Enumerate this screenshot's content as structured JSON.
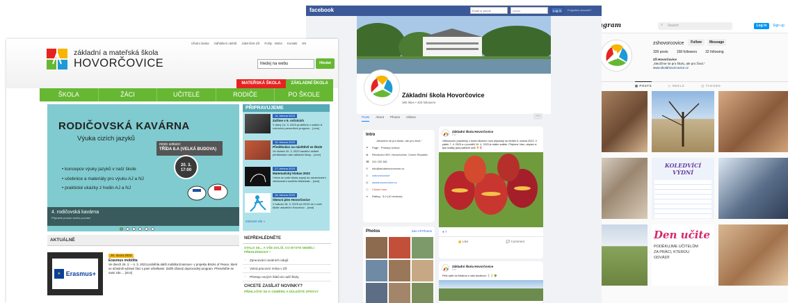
{
  "instagram": {
    "logo": "Instagram",
    "search_placeholder": "Search",
    "login": "Log in",
    "signup": "Sign up",
    "handle": "zshovorcovice",
    "follow": "Follow",
    "message": "Message",
    "stats": [
      "339 posts",
      "158 followers",
      "32 following"
    ],
    "bio_name": "ZŠ Hovorčovice",
    "bio_line": "„Neučíme se pro školu, ale pro život.“",
    "bio_link": "www.skolahovorcovice.cz",
    "tabs": [
      "POSTS",
      "REELS",
      "TAGGED"
    ],
    "tile_koledy": "KOLEDVÍCÍ VÝDNÍ",
    "tile_den_ucitelu": "Den učite",
    "tile_den_sub": "PODĚKUJME UČITELŮM ZA PRÁCI, KTEROU ODVÁDÍ!"
  },
  "facebook": {
    "logo": "facebook",
    "email_placeholder": "Email or phone",
    "password_mask": "••••••••",
    "login": "Log in",
    "forgot": "Forgotten account?",
    "page_name": "Základní škola Hovorčovice",
    "likes": "380 likes • 400 followers",
    "tabs": [
      "Posts",
      "About",
      "Photos",
      "Videos"
    ],
    "more": "···",
    "intro_title": "Intro",
    "intro_quote": "„Neučíme se pro školu, ale pro život.“",
    "intro_rows": [
      "Page · Primary school",
      "Revoluční 900, Hovorčovice, Czech Republic",
      "311 232 381",
      "info@skolahovorcovice.cz",
      "zshovorcovice",
      "skolahovorcovice.cz",
      "Closed now",
      "Rating · 5.0 (10 reviews)"
    ],
    "photos_title": "Photos",
    "photos_link": "See All Photos",
    "post1_name": "Základní škola Hovorčovice",
    "post1_time": "2 d ·",
    "post1_text": "Velikonoční prázdniny v tomto školním roce připadají na čtvrtek 6. dubna 2023. V pátek 7. 4. 2023 a v pondělí 10. 4. 2023 je státní svátek. Přejeme Vám, abyste si tyto svátky jara patřičně užili 🐣🌷",
    "reactions": "7",
    "like": "Like",
    "comment": "Comment",
    "post2_name": "Základní škola Hovorčovice",
    "post2_time": "4 d ·",
    "post2_text": "Pěší výlet do Mratína s naší družinou! 🚶🚶🌳"
  },
  "school": {
    "top_links": [
      "Úřední deska",
      "Odhlášení obědů",
      "Jídelníček ZŠ",
      "Pošty · Webs",
      "Kontakt",
      "EN"
    ],
    "title1": "základní a mateřská škola",
    "title2": "HOVORČOVICE",
    "search_value": "hledej na webu",
    "search_btn": "Hledat",
    "seg_ms": "MATEŘSKÁ ŠKOLA",
    "seg_zs": "ZÁKLADNÍ ŠKOLA",
    "nav": [
      "ŠKOLA",
      "ŽÁCI",
      "UČITELÉ",
      "RODIČE",
      "PO ŠKOLE"
    ],
    "banner": {
      "title": "RODIČOVSKÁ KAVÁRNA",
      "subtitle": "Výuka cizích jazyků",
      "pill_line1": "místo setkání:",
      "pill_line2": "TŘÍDA 8.A (VELKÁ BUDOVA)",
      "clock_date": "20. 3.",
      "clock_time": "17:00",
      "list": [
        "koncepce výuky jazyků v naší škole",
        "učebnice a materiály pro výuku AJ a NJ",
        "praktické ukázky z hodin AJ a NJ"
      ],
      "caption": "4. rodičovská kavárna",
      "caption_sub": "Připravte prosím svého pozvání"
    },
    "side": {
      "heading": "PŘIPRAVUJEME",
      "items": [
        {
          "date": "14. března 2023",
          "title": "Zuříme v 6. ročnících",
          "text": "V úterý 14. 3. 2023 proběhne v našich 6. ročnících preventivní program... [více]"
        },
        {
          "date": "16. března 2023",
          "title": "Předškoláci na návštěvě ve škole",
          "text": "Ve čtvrtek 16. 3. 2023 navštíví učitelé předškoláci naší základní školy... [více]"
        },
        {
          "date": "17. března 2023",
          "title": "Matematický klokan 2023",
          "text": "I letos se naše škola zapojí do mezinárodní vědomostní soutěže Matemati... [více]"
        },
        {
          "date": "18. března 2023",
          "title": "Obecní ples Hovorčovice",
          "text": "V sobotu 18. 3. 2023 od 20:00 se v naší škole uskuteční Hovorčov... [více]"
        }
      ],
      "more": "Zobrazit vše"
    },
    "aktualne": "AKTUÁLNĚ",
    "news": {
      "date": "26. února 2023",
      "title": "Erasmus mobilita",
      "text": "Ve dnech 26. 2. – 4. 3. 2023 proběhla další mobilita Erasmus+ v projektu Bricks of Peace, které se účastnili vybraní žáci s paní učitelkami. Zažili úžasný doprovodný program. Přesvědčte se sami zde.... [více]",
      "logo": "Erasmus+"
    },
    "notice": {
      "heading": "NEPŘEHLÉDNĚTE",
      "green": "STALO SE... A VŠE DALŠÍ, CO BYSTE NEMĚLI PŘEHLÉDNOUT !",
      "items": [
        "Zpracování osobních údajů",
        "Volná pracovní místa v ZŠ",
        "Přestup nových žáků do naší školy"
      ],
      "heading2": "CHCETE ZASÍLAT NOVINKY?",
      "green2": "PŘIHLAŠTE SE K ODBĚRU A DŮLEŽITÉ ZPRÁVY"
    }
  },
  "colors": {
    "school_green": "#66b833",
    "ms_red": "#e52421",
    "fb_blue": "#3b5998",
    "ig_blue": "#0095f6",
    "side_blue": "#2b66b7"
  }
}
